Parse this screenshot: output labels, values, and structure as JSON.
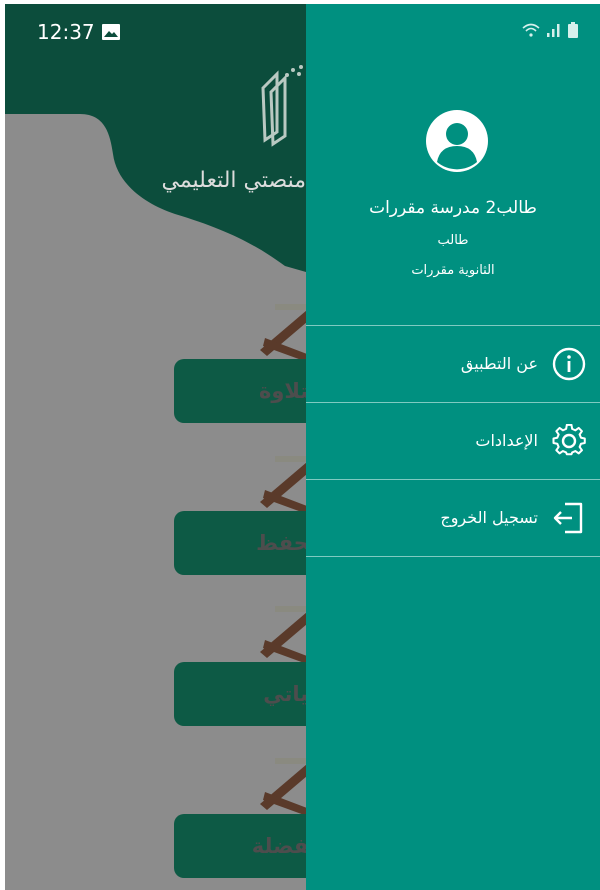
{
  "status_bar": {
    "time": "12:37"
  },
  "background_app": {
    "title": "منصتي التعليمي",
    "cards": [
      {
        "label": "التلاوة"
      },
      {
        "label": "الحفظ"
      },
      {
        "label": "حياتي"
      },
      {
        "label": "الفضلة"
      }
    ]
  },
  "drawer": {
    "profile": {
      "name": "طالب2 مدرسة  مقررات",
      "role": "طالب",
      "school": "الثانوية مقررات"
    },
    "menu": [
      {
        "label": "عن التطبيق",
        "icon": "info-icon"
      },
      {
        "label": "الإعدادات",
        "icon": "gear-icon"
      },
      {
        "label": "تسجيل الخروج",
        "icon": "logout-icon"
      }
    ]
  },
  "colors": {
    "drawer": "#009080",
    "header": "#0c4d3c",
    "scrim": "#8c8c8c"
  }
}
